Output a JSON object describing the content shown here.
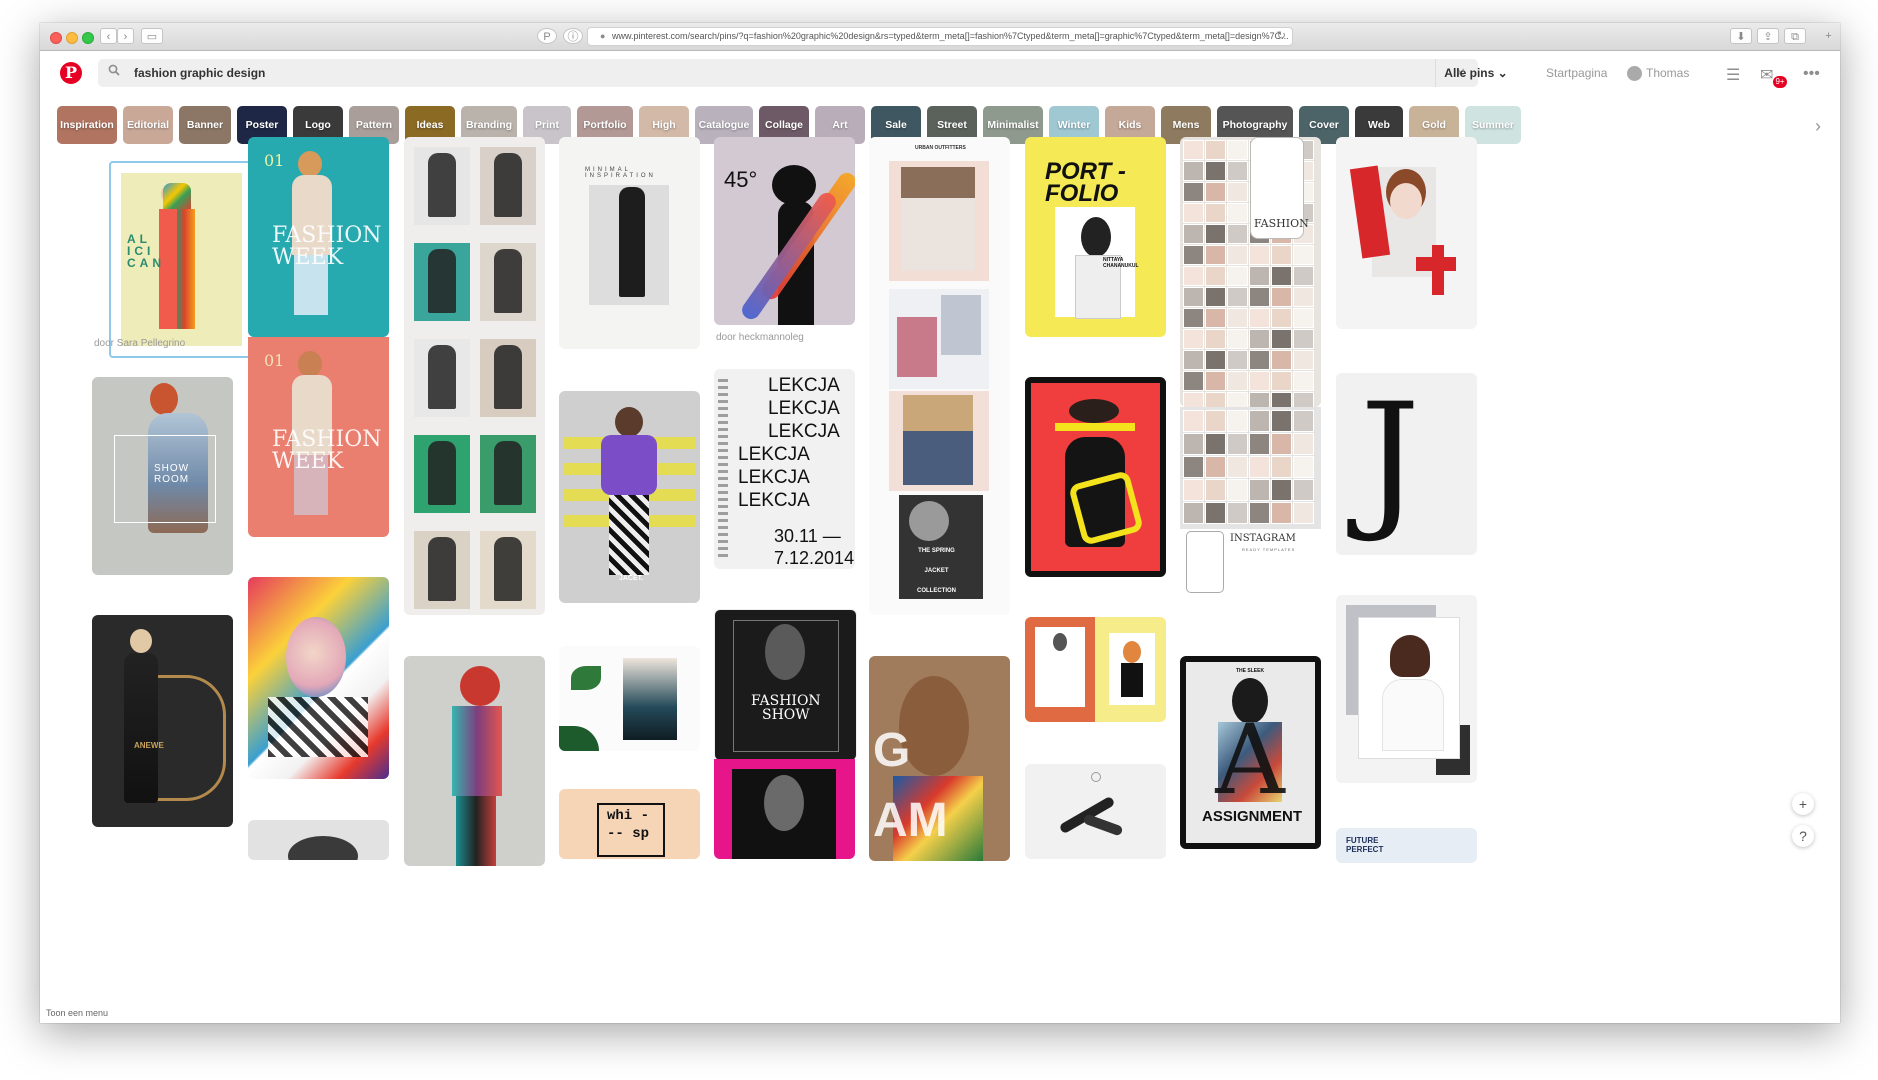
{
  "browser": {
    "url": "www.pinterest.com/search/pins/?q=fashion%20graphic%20design&rs=typed&term_meta[]=fashion%7Ctyped&term_meta[]=graphic%7Ctyped&term_meta[]=design%7C..."
  },
  "header": {
    "search_query": "fashion graphic design",
    "scope": "Alle pins",
    "nav": {
      "home": "Startpagina",
      "user": "Thomas"
    },
    "notifications_badge": "9+"
  },
  "chips": [
    {
      "label": "Inspiration",
      "color": "#b07461"
    },
    {
      "label": "Editorial",
      "color": "#c9a898"
    },
    {
      "label": "Banner",
      "color": "#8c7766"
    },
    {
      "label": "Poster",
      "color": "#1e2745"
    },
    {
      "label": "Logo",
      "color": "#3a3a3a"
    },
    {
      "label": "Pattern",
      "color": "#a99e99"
    },
    {
      "label": "Ideas",
      "color": "#8b6b24"
    },
    {
      "label": "Branding",
      "color": "#bab3ac"
    },
    {
      "label": "Print",
      "color": "#c8c4c9"
    },
    {
      "label": "Portfolio",
      "color": "#b39995"
    },
    {
      "label": "High",
      "color": "#d2b9a8"
    },
    {
      "label": "Catalogue",
      "color": "#b9b2bd"
    },
    {
      "label": "Collage",
      "color": "#6d5a66"
    },
    {
      "label": "Art",
      "color": "#b8adb8"
    },
    {
      "label": "Sale",
      "color": "#3f5760"
    },
    {
      "label": "Street",
      "color": "#5b625b"
    },
    {
      "label": "Minimalist",
      "color": "#8f9a8f"
    },
    {
      "label": "Winter",
      "color": "#9fc8d2"
    },
    {
      "label": "Kids",
      "color": "#c4a898"
    },
    {
      "label": "Mens",
      "color": "#8e7a5e"
    },
    {
      "label": "Photography",
      "color": "#555555"
    },
    {
      "label": "Cover",
      "color": "#4c6468"
    },
    {
      "label": "Web",
      "color": "#3a3a3a"
    },
    {
      "label": "Gold",
      "color": "#c9b398"
    },
    {
      "label": "Summer",
      "color": "#cfe3e0"
    }
  ],
  "pins": {
    "p1": {
      "author": "door Sara Pellegrino",
      "text": "AL\nICI\nCAN"
    },
    "p2": {
      "text": "SHOW\nROOM"
    },
    "p3": {
      "text": "ANEWE"
    },
    "p4": {
      "num": "01",
      "text": "FASHION\nWEEK"
    },
    "p5": {
      "num": "01",
      "text": "FASHION\nWEEK"
    },
    "p7": {
      "text": "MINIMAL INSPIRATION"
    },
    "p8": {
      "text": "JACET."
    },
    "p9": {
      "text": "whi -\n-- sp"
    },
    "p10": {
      "author": "door heckmannoleg",
      "text": "45°"
    },
    "p11": {
      "lines": [
        "LEKCJA",
        "LEKCJA",
        "LEKCJA",
        "LEKCJA",
        "LEKCJA",
        "LEKCJA"
      ],
      "dates": "30.11 —\n7.12.2014"
    },
    "p12": {
      "text": "FASHION\nSHOW"
    },
    "p13": {
      "text": "URBAN OUTFITTERS"
    },
    "p14": {
      "text": "THE SPRING\nJACKET\nCOLLECTION"
    },
    "p15": {
      "text": "G\nAM"
    },
    "p16": {
      "title": "PORT -\nFOLIO",
      "name": "NITTAYA\nCHANANUKUL"
    },
    "p18": {
      "text": "FASHION"
    },
    "p19": {
      "title": "INSTAGRAM",
      "sub": "READY TEMPLATES"
    },
    "p20": {
      "top": "THE SLEEK",
      "text": "ASSIGNMENT"
    },
    "p21": {
      "text": "J"
    },
    "p22": {
      "text": "FUTURE\nPERFECT"
    }
  },
  "footer": {
    "menu_hint": "Toon een menu",
    "plus": "+",
    "help": "?"
  }
}
